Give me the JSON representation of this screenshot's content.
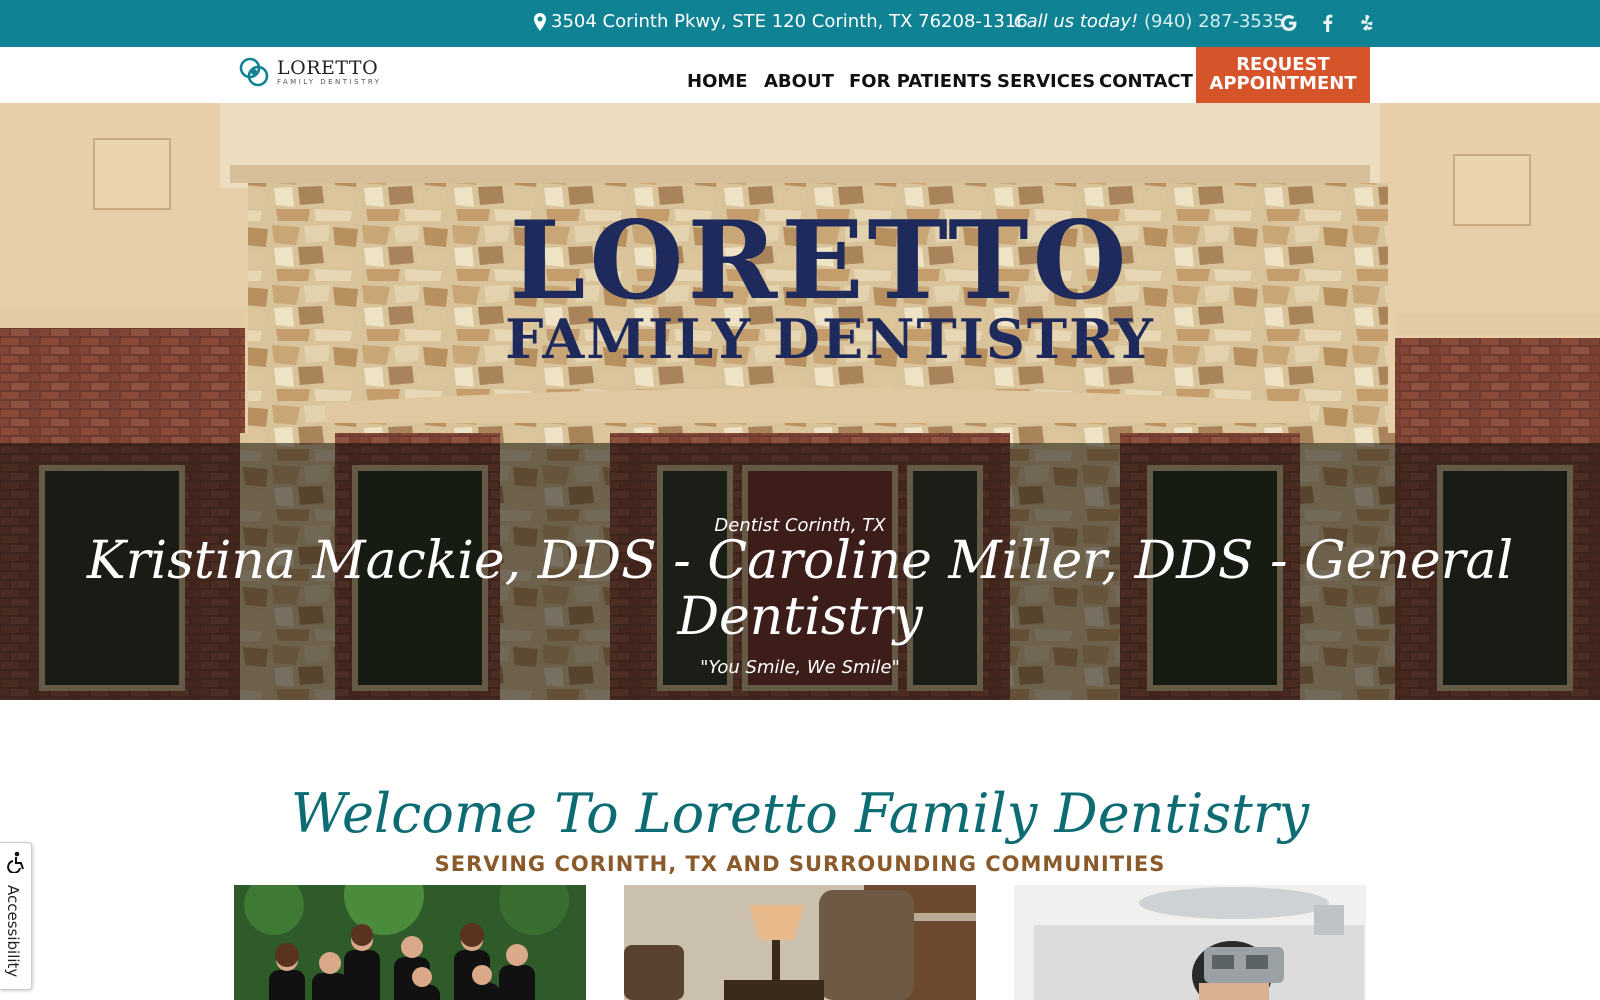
{
  "topbar": {
    "address": "3504 Corinth Pkwy, STE 120 Corinth, TX 76208-1316",
    "call_label": "Call us today!",
    "phone": "(940) 287-3535",
    "social": [
      "google-icon",
      "facebook-icon",
      "yelp-icon"
    ]
  },
  "logo": {
    "name": "LORETTO",
    "tagline": "FAMILY DENTISTRY"
  },
  "nav": {
    "items": [
      "HOME",
      "ABOUT",
      "FOR PATIENTS",
      "SERVICES",
      "CONTACT"
    ],
    "cta_line1": "REQUEST",
    "cta_line2": "APPOINTMENT"
  },
  "hero": {
    "sign_line1": "LORETTO",
    "sign_line2": "FAMILY DENTISTRY",
    "subtitle": "Dentist Corinth, TX",
    "title": "Kristina Mackie, DDS - Caroline Miller, DDS - General Dentistry",
    "tagline": "\"You Smile, We Smile\""
  },
  "welcome": {
    "title": "Welcome To Loretto Family Dentistry",
    "subtitle": "SERVING CORINTH, TX AND SURROUNDING COMMUNITIES"
  },
  "accessibility": {
    "label": "Accessibility"
  },
  "colors": {
    "topbar": "#0f8293",
    "cta": "#d6542a",
    "welcome": "#0d6c73",
    "serving": "#8a5a2a"
  }
}
